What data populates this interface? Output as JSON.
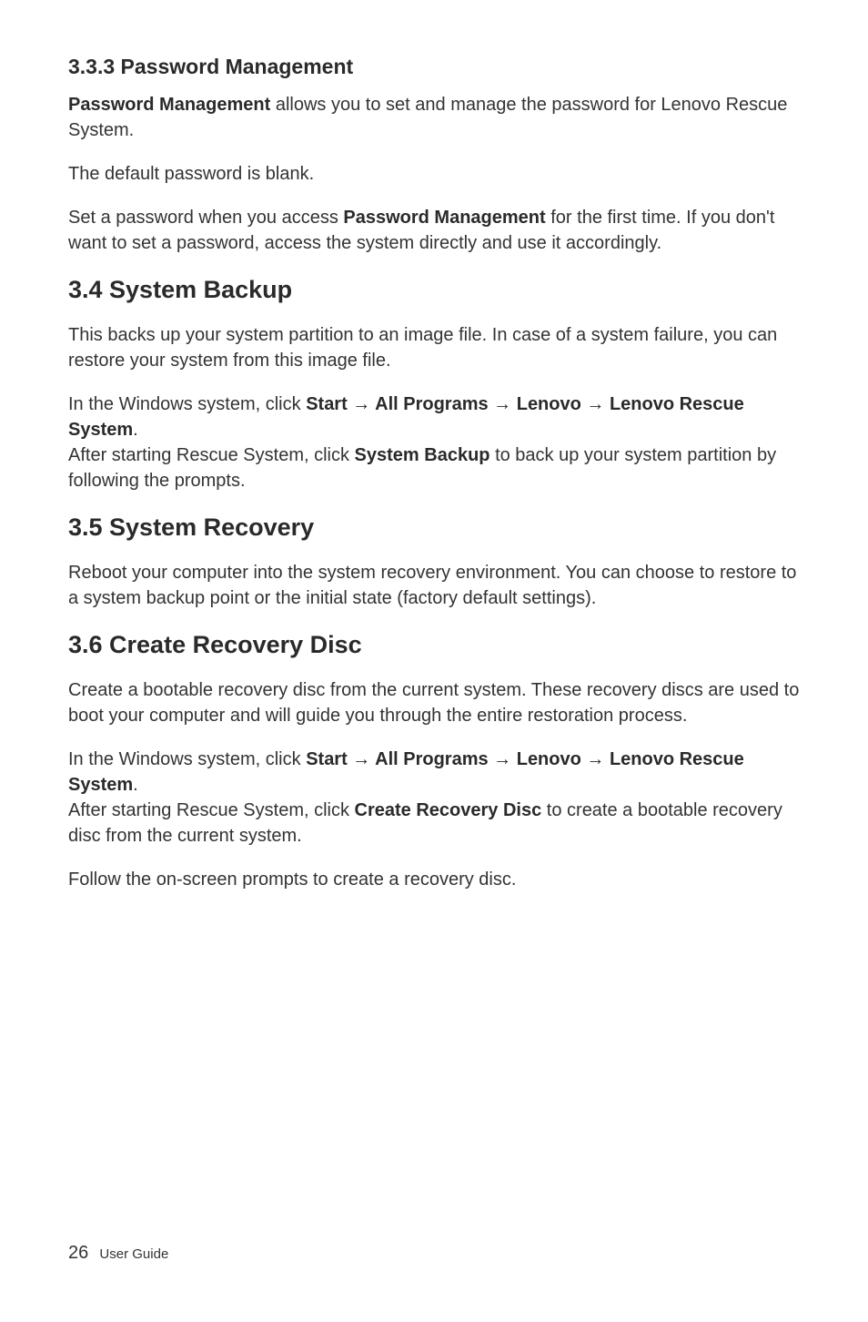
{
  "s333": {
    "heading": "3.3.3 Password Management",
    "p1_bold": "Password Management",
    "p1_text": " allows you to set and manage the password for Lenovo Rescue System.",
    "p2": "The default password is blank.",
    "p3_pre": "Set a password when you access ",
    "p3_bold": "Password Management",
    "p3_post": " for the first time. If you don't want to set a password, access the system directly and use it accordingly."
  },
  "s34": {
    "heading": "3.4 System Backup",
    "p1": "This backs up your system partition to an image file. In case of a system failure, you can restore your system from this image file.",
    "p2_pre": "In the Windows system, click ",
    "p2_bold": "Start → All Programs → Lenovo → Lenovo Rescue System",
    "p2_post": ".",
    "p3_pre": "After starting Rescue System, click ",
    "p3_bold": "System Backup",
    "p3_post": " to back up your system partition by following the prompts."
  },
  "s35": {
    "heading": "3.5 System Recovery",
    "p1": "Reboot your computer into the system recovery environment. You can choose to restore to a system backup point or the initial state (factory default settings)."
  },
  "s36": {
    "heading": "3.6 Create Recovery Disc",
    "p1": "Create a bootable recovery disc from the current system. These recovery discs are used to boot your computer and will guide you through the entire restoration process.",
    "p2_pre": "In the Windows system, click ",
    "p2_bold": "Start → All Programs → Lenovo → Lenovo Rescue System",
    "p2_post": ".",
    "p3_pre": "After starting Rescue System, click ",
    "p3_bold": "Create Recovery Disc",
    "p3_post": " to create a bootable recovery disc from the current system.",
    "p4": "Follow the on-screen prompts to create a recovery disc."
  },
  "footer": {
    "page_number": "26",
    "label": "User Guide"
  }
}
